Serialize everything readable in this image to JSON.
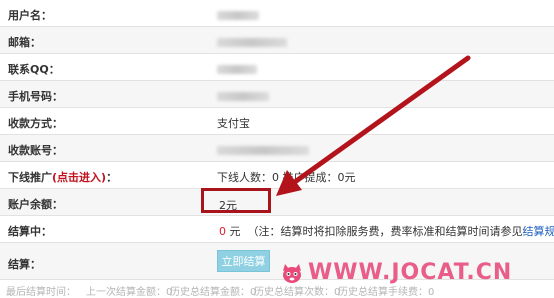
{
  "rows": {
    "username": {
      "label": "用户名："
    },
    "email": {
      "label": "邮箱："
    },
    "qq": {
      "label": "联系QQ："
    },
    "phone": {
      "label": "手机号码："
    },
    "payment_method": {
      "label": "收款方式：",
      "value": "支付宝"
    },
    "payment_account": {
      "label": "收款账号："
    },
    "downline": {
      "label_prefix": "下线推广",
      "label_link": "(点击进入)",
      "label_suffix": "：",
      "value": "下线人数：0  推广提成：0元"
    },
    "balance": {
      "label": "账户余额：",
      "value": "2元"
    },
    "settling": {
      "label": "结算中：",
      "amount": "0",
      "unit": " 元",
      "note": "（注：结算时将扣除服务费，费率标准和结算时间请参见",
      "link": "结算规则",
      "note_end": "）"
    },
    "settle": {
      "label": "结算：",
      "button": "立即结算"
    }
  },
  "footer": {
    "last_time": "最后结算时间：",
    "last_amount": "上一次结算金额：0",
    "history_amount": "历史总结算金额：0",
    "history_count": "历史总结算次数：0",
    "history_fee": "历史总结算手续费：0"
  },
  "watermark": {
    "text": "WWW.JOCAT.CN"
  },
  "colors": {
    "highlight": "#a8141b",
    "arrow": "#b3141c",
    "button": "#8fd1e2",
    "watermark": "#e84a7a"
  }
}
